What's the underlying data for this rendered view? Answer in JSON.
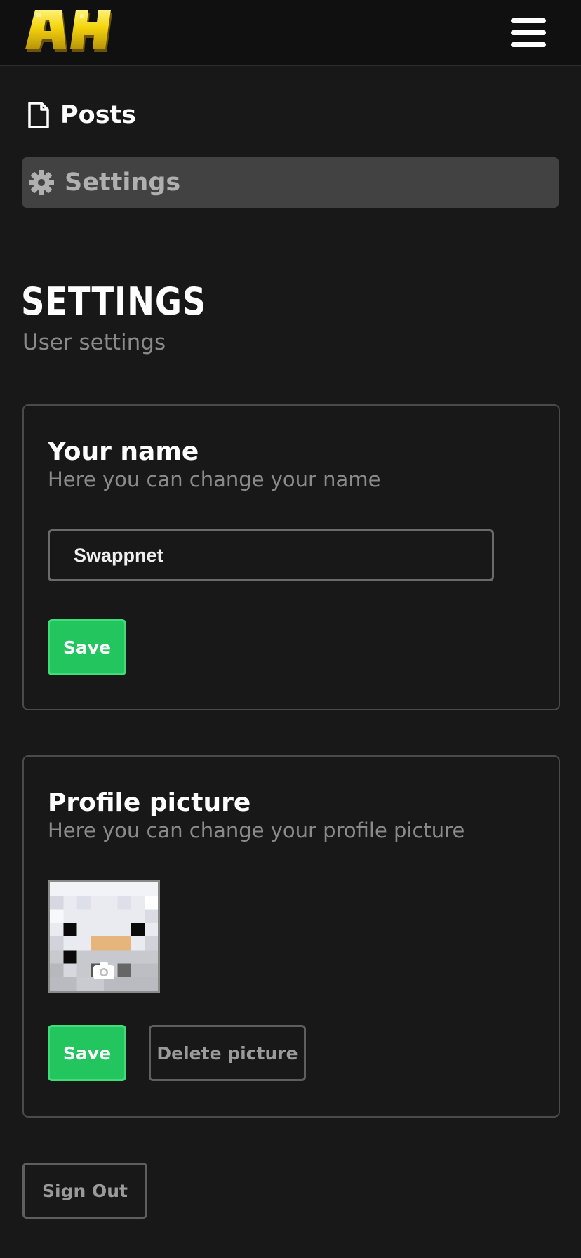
{
  "header": {
    "logo_text": "AH",
    "menu_icon": "hamburger-menu-icon"
  },
  "nav": {
    "posts": {
      "label": "Posts",
      "icon": "document-icon"
    },
    "settings": {
      "label": "Settings",
      "icon": "gear-icon",
      "active": true
    }
  },
  "page": {
    "title": "SETTINGS",
    "subtitle": "User settings"
  },
  "name_card": {
    "title": "Your name",
    "description": "Here you can change your name",
    "input_value": "Swappnet",
    "save_label": "Save"
  },
  "picture_card": {
    "title": "Profile picture",
    "description": "Here you can change your profile picture",
    "avatar_icon": "camera-icon",
    "save_label": "Save",
    "delete_label": "Delete picture"
  },
  "sign_out_label": "Sign Out",
  "colors": {
    "background": "#181818",
    "accent_green": "#22c55e",
    "logo_yellow": "#f5d90a"
  }
}
